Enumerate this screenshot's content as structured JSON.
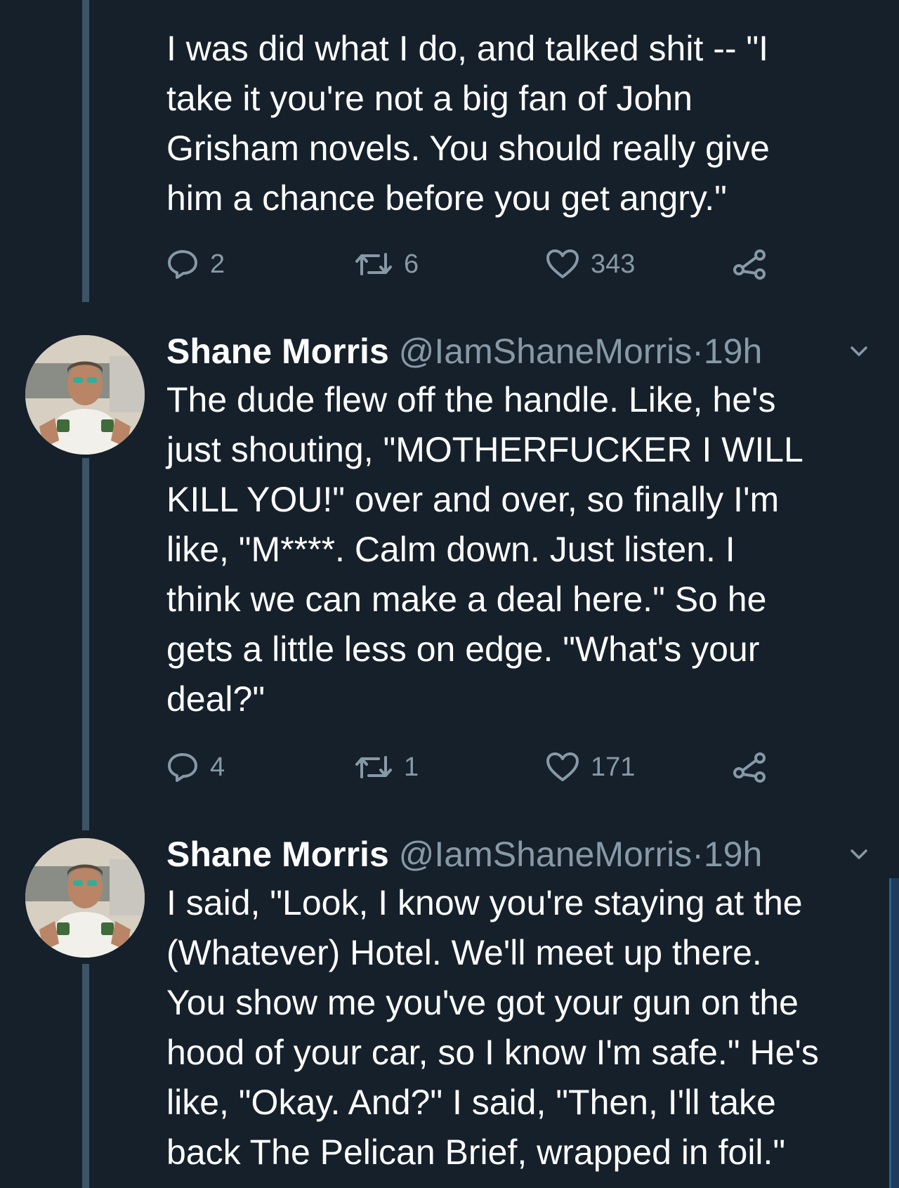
{
  "tweets": [
    {
      "text": "I was did what I do, and talked shit -- \"I\ntake it you're not a big fan of John\nGrisham novels. You should really give\nhim a chance before you get angry.\"",
      "replies": "2",
      "retweets": "6",
      "likes": "343"
    },
    {
      "name": "Shane Morris",
      "handle": "@IamShaneMorris",
      "separator": "·",
      "time": "19h",
      "text": "The dude flew off the handle. Like, he's\njust shouting, \"MOTHERFUCKER I WILL\nKILL YOU!\" over and over, so finally I'm\nlike, \"M****. Calm down. Just listen. I\nthink we can make a deal here.\" So he\ngets a little less on edge. \"What's your\ndeal?\"",
      "replies": "4",
      "retweets": "1",
      "likes": "171"
    },
    {
      "name": "Shane Morris",
      "handle": "@IamShaneMorris",
      "separator": "·",
      "time": "19h",
      "text": "I said, \"Look, I know you're staying at the\n(Whatever) Hotel. We'll meet up there.\nYou show me you've got your gun on the\nhood of your car, so I know I'm safe.\" He's\nlike, \"Okay. And?\" I said, \"Then, I'll take\nback The Pelican Brief, wrapped in foil.\""
    }
  ],
  "icons": {
    "reply": "reply-icon",
    "retweet": "retweet-icon",
    "like": "heart-icon",
    "share": "share-icon",
    "more": "chevron-down-icon"
  },
  "colors": {
    "background": "#15202b",
    "text": "#ffffff",
    "muted": "#8899a6",
    "thread_line": "#3d5466"
  }
}
